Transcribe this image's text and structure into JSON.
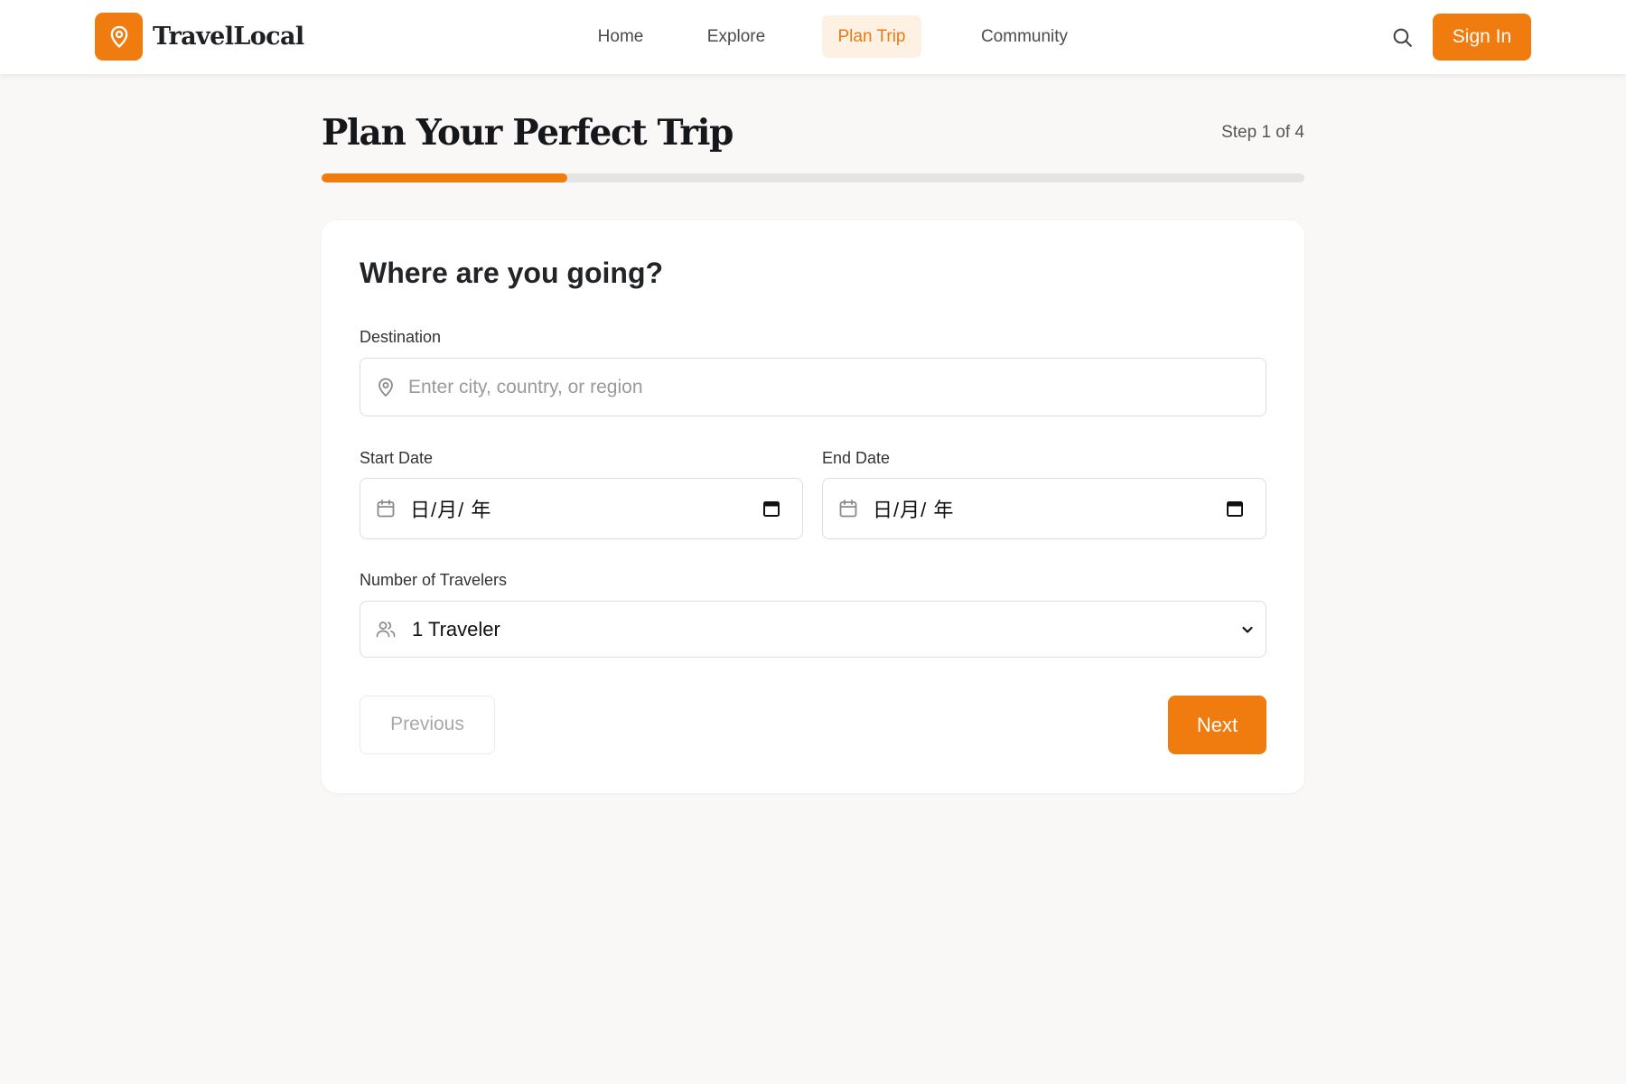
{
  "brand": {
    "name": "TravelLocal",
    "icon": "map-pin-icon",
    "accent_color": "#f07c10"
  },
  "nav": {
    "items": [
      {
        "label": "Home",
        "active": false
      },
      {
        "label": "Explore",
        "active": false
      },
      {
        "label": "Plan Trip",
        "active": true
      },
      {
        "label": "Community",
        "active": false
      }
    ],
    "search_icon": "search-icon",
    "sign_in_label": "Sign In"
  },
  "page": {
    "title": "Plan Your Perfect Trip",
    "step_label": "Step 1 of 4",
    "progress_fraction": 0.25
  },
  "form": {
    "heading": "Where are you going?",
    "destination": {
      "label": "Destination",
      "placeholder": "Enter city, country, or region",
      "value": "",
      "icon": "map-pin-icon"
    },
    "start_date": {
      "label": "Start Date",
      "value": "日/月/ 年",
      "icon": "calendar-icon"
    },
    "end_date": {
      "label": "End Date",
      "value": "日/月/ 年",
      "icon": "calendar-icon"
    },
    "travelers": {
      "label": "Number of Travelers",
      "value": "1 Traveler",
      "icon": "users-icon"
    },
    "previous_label": "Previous",
    "next_label": "Next"
  }
}
